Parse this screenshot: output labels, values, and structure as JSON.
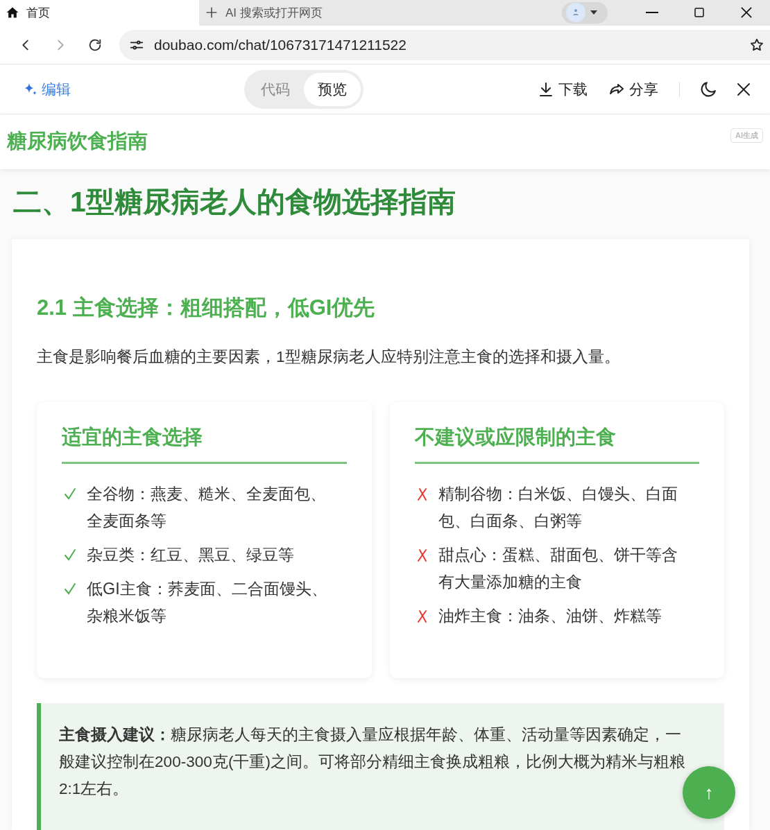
{
  "browser": {
    "tabs": [
      {
        "label": "首页",
        "kind": "page",
        "selected": true
      },
      {
        "label": "AI 搜索或打开网页",
        "kind": "new",
        "selected": false
      }
    ],
    "url": "doubao.com/chat/10673171471211522"
  },
  "toolbar": {
    "edit": "编辑",
    "view_toggle": [
      {
        "label": "代码",
        "selected": false
      },
      {
        "label": "预览",
        "selected": true
      }
    ],
    "download": "下载",
    "share": "分享"
  },
  "doc": {
    "title": "糖尿病饮食指南",
    "badge": "AI生成",
    "section_heading": "二、1型糖尿病老人的食物选择指南",
    "subheading": "2.1 主食选择：粗细搭配，低GI优先",
    "intro": "主食是影响餐后血糖的主要因素，1型糖尿病老人应特别注意主食的选择和摄入量。",
    "columns": [
      {
        "title": "适宜的主食选择",
        "kind": "good",
        "items": [
          "全谷物：燕麦、糙米、全麦面包、全麦面条等",
          "杂豆类：红豆、黑豆、绿豆等",
          "低GI主食：荞麦面、二合面馒头、杂粮米饭等"
        ]
      },
      {
        "title": "不建议或应限制的主食",
        "kind": "bad",
        "items": [
          "精制谷物：白米饭、白馒头、白面包、白面条、白粥等",
          "甜点心：蛋糕、甜面包、饼干等含有大量添加糖的主食",
          "油炸主食：油条、油饼、炸糕等"
        ]
      }
    ],
    "tip": "**主食摄入建议：**糖尿病老人每天的主食摄入量应根据年龄、体重、活动量等因素确定，一般建议控制在200-300克(干重)之间。可将部分精细主食换成粗粮，比例大概为精米与粗粮2:1左右。",
    "scroll_top": "↑"
  }
}
